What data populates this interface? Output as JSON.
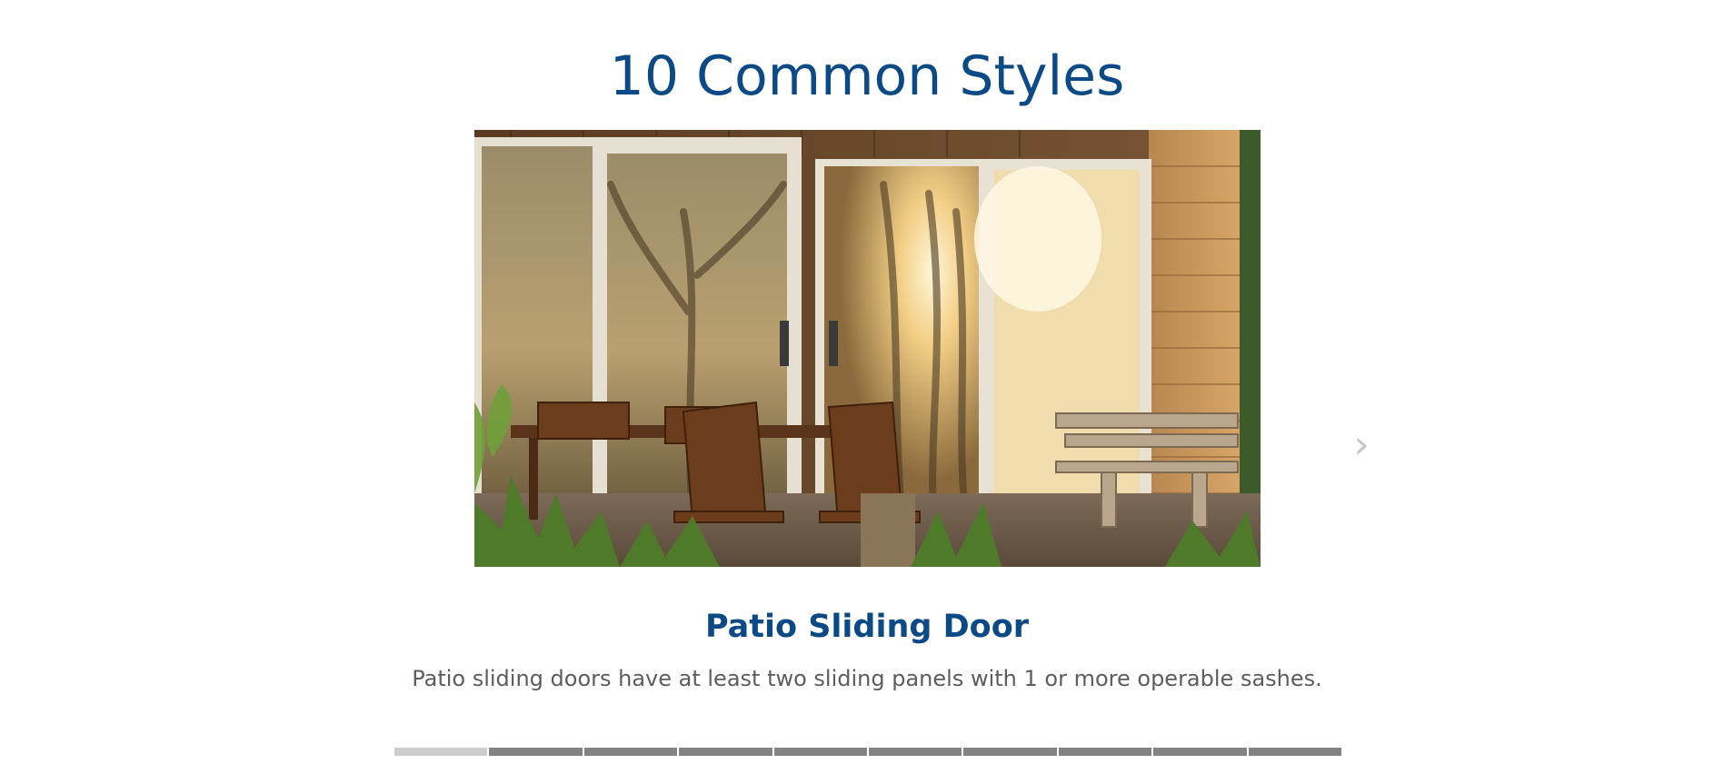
{
  "section": {
    "title": "10 Common Styles"
  },
  "slide": {
    "heading": "Patio Sliding Door",
    "description": "Patio sliding doors have at least two sliding panels with 1 or more operable sashes.",
    "image_icon": "patio-door-photo",
    "next_icon": "›"
  },
  "slider": {
    "total_slides": 10,
    "current_slide": 1
  },
  "colors": {
    "heading": "#0b4a86",
    "body_text": "#5d5d5d",
    "progress_active": "#cdcdcd",
    "progress_inactive": "#838383",
    "arrow": "#c8c8c8"
  }
}
